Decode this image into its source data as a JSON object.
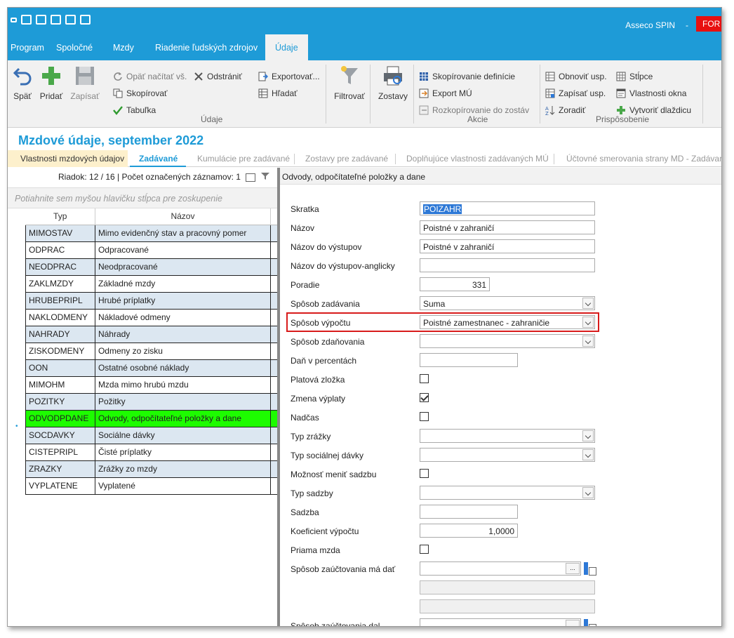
{
  "titlebar": {
    "app_name": "Asseco SPIN",
    "separator": "-",
    "red_label": "FOR"
  },
  "menu": [
    "Program",
    "Spoločné",
    "Mzdy",
    "Riadenie ľudských zdrojov",
    "Údaje"
  ],
  "ribbon": {
    "back": "Späť",
    "add": "Pridať",
    "save": "Zapísať",
    "reload": "Opäť načítať vš.",
    "delete": "Odstrániť",
    "copy": "Skopírovať",
    "table": "Tabuľka",
    "export": "Exportovať...",
    "search": "Hľadať",
    "group_data": "Údaje",
    "filter": "Filtrovať",
    "reports": "Zostavy",
    "copy_def": "Skopírovanie definície",
    "export_mu": "Export MÚ",
    "copy_reports": "Rozkopírovanie do zostáv",
    "group_actions": "Akcie",
    "refresh": "Obnoviť usp.",
    "write": "Zapísať usp.",
    "sort": "Zoradiť",
    "columns": "Stĺpce",
    "window_props": "Vlastnosti okna",
    "create_tile": "Vytvoriť dlaždicu",
    "group_custom": "Prispôsobenie"
  },
  "page_title": "Mzdové údaje, september 2022",
  "tabs": [
    "Vlastnosti mzdových údajov",
    "Zadávané",
    "Kumulácie pre zadávané",
    "Zostavy pre zadávané",
    "Doplňujúce vlastnosti zadávaných MÚ",
    "Účtovné smerovania strany MD - Zadávané"
  ],
  "left": {
    "row_info": "Riadok: 12 / 16 | Počet označených záznamov: 1",
    "group_hint": "Potiahnite sem myšou hlavičku stĺpca pre zoskupenie",
    "columns": [
      "Typ",
      "Názov"
    ],
    "rows": [
      [
        "MIMOSTAV",
        "Mimo evidenčný stav a pracovný pomer"
      ],
      [
        "ODPRAC",
        "Odpracované"
      ],
      [
        "NEODPRAC",
        "Neodpracované"
      ],
      [
        "ZAKLMZDY",
        "Základné mzdy"
      ],
      [
        "HRUBEPRIPL",
        "Hrubé príplatky"
      ],
      [
        "NAKLODMENY",
        "Nákladové odmeny"
      ],
      [
        "NAHRADY",
        "Náhrady"
      ],
      [
        "ZISKODMENY",
        "Odmeny zo zisku"
      ],
      [
        "OON",
        "Ostatné osobné náklady"
      ],
      [
        "MIMOHM",
        "Mzda mimo hrubú mzdu"
      ],
      [
        "POZITKY",
        "Požitky"
      ],
      [
        "ODVODPDANE",
        "Odvody, odpočítateľné položky a dane"
      ],
      [
        "SOCDAVKY",
        "Sociálne dávky"
      ],
      [
        "CISTEPRIPL",
        "Čisté príplatky"
      ],
      [
        "ZRAZKY",
        "Zrážky zo mzdy"
      ],
      [
        "VYPLATENE",
        "Vyplatené"
      ]
    ],
    "selected_row": 11,
    "row_marker": "•"
  },
  "right": {
    "header": "Odvody, odpočítateľné položky a dane",
    "labels": {
      "skratka": "Skratka",
      "nazov": "Názov",
      "nazov_vystup": "Názov do výstupov",
      "nazov_vystup_en": "Názov do výstupov-anglicky",
      "poradie": "Poradie",
      "sposob_zadavania": "Spôsob zadávania",
      "sposob_vypoctu": "Spôsob výpočtu",
      "sposob_zdanovania": "Spôsob zdaňovania",
      "dan_perc": "Daň v percentách",
      "platova": "Platová zložka",
      "zmena": "Zmena výplaty",
      "nadcas": "Nadčas",
      "typ_zrazky": "Typ zrážky",
      "typ_soc": "Typ sociálnej dávky",
      "moznost": "Možnosť meniť sadzbu",
      "typ_sadzby": "Typ sadzby",
      "sadzba": "Sadzba",
      "koef": "Koeficient výpočtu",
      "priama": "Priama mzda",
      "uct_md": "Spôsob zaúčtovania má dať",
      "uct_dal": "Spôsob zaúčtovania dal"
    },
    "values": {
      "skratka": "POIZAHR",
      "nazov": "Poistné v zahraničí",
      "nazov_vystup": "Poistné v zahraničí",
      "poradie": "331",
      "sposob_zadavania": "Suma",
      "sposob_vypoctu": "Poistné zamestnanec - zahraničie",
      "koef": "1,0000",
      "ellipsis": "..."
    },
    "checks": {
      "platova": false,
      "zmena": true,
      "nadcas": false,
      "moznost": false,
      "priama": false
    }
  }
}
